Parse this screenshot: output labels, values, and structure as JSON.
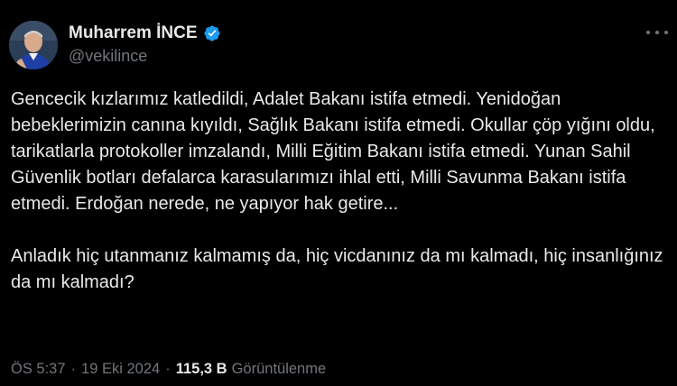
{
  "author": {
    "display_name": "Muharrem İNCE",
    "handle": "@vekilince",
    "verified_icon": "verified-badge-icon",
    "avatar_icon": "profile-avatar"
  },
  "tweet": {
    "paragraph_1": "Gencecik kızlarımız katledildi, Adalet Bakanı istifa etmedi. Yenidoğan bebeklerimizin canına kıyıldı, Sağlık Bakanı istifa etmedi. Okullar çöp yığını oldu, tarikatlarla protokoller imzalandı, Milli Eğitim Bakanı istifa etmedi. Yunan Sahil Güvenlik botları defalarca karasularımızı ihlal etti, Milli Savunma Bakanı istifa etmedi. Erdoğan nerede, ne yapıyor hak getire...",
    "paragraph_2": "Anladık hiç utanmanız kalmamış da, hiç vicdanınız da mı kalmadı, hiç insanlığınız da mı kalmadı?"
  },
  "meta": {
    "time": "ÖS 5:37",
    "separator_1": "·",
    "date": "19 Eki 2024",
    "separator_2": "·",
    "views_count": "115,3 B",
    "views_label": "Görüntülenme"
  },
  "colors": {
    "background": "#000000",
    "primary_text": "#e7e9ea",
    "secondary_text": "#71767b",
    "verified_blue": "#1d9bf0"
  },
  "menu": {
    "more_icon": "more-horizontal-icon"
  }
}
